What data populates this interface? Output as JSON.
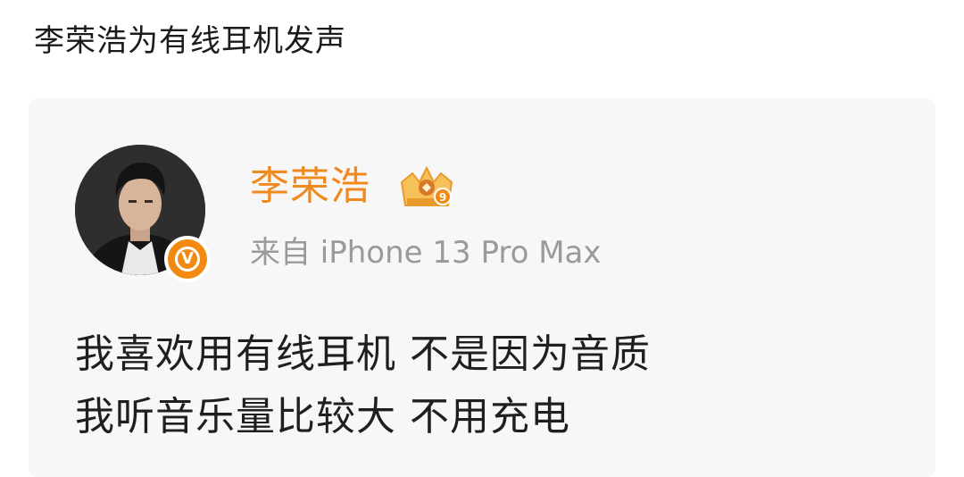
{
  "headline": "李荣浩为有线耳机发声",
  "post": {
    "user_name": "李荣浩",
    "source": "来自 iPhone 13 Pro Max",
    "verified_icon": "verified-v-icon",
    "badge_icon": "crown-level-badge-icon",
    "badge_level": "9",
    "verified_glyph": "V",
    "lines": [
      "我喜欢用有线耳机 不是因为音质",
      "我听音乐量比较大 不用充电"
    ]
  },
  "colors": {
    "name": "#f08a1f",
    "verified": "#f28a12",
    "source": "#9a9a9a",
    "text": "#1f1f1f",
    "card": "#f7f7f7"
  }
}
